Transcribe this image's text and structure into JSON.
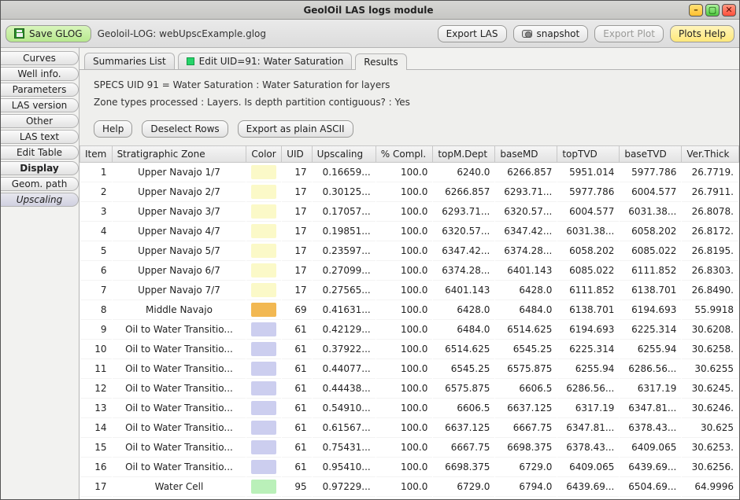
{
  "window": {
    "title": "GeolOil LAS logs module"
  },
  "toolbar": {
    "save": "Save GLOG",
    "filepath": "Geoloil-LOG: webUpscExample.glog",
    "export_las": "Export LAS",
    "snapshot": "snapshot",
    "export_plot": "Export Plot",
    "plots_help": "Plots Help"
  },
  "sidebar": {
    "items": [
      {
        "label": "Curves"
      },
      {
        "label": "Well info."
      },
      {
        "label": "Parameters"
      },
      {
        "label": "LAS version"
      },
      {
        "label": "Other"
      },
      {
        "label": "LAS text"
      },
      {
        "label": "Edit Table"
      },
      {
        "label": "Display",
        "bold": true
      },
      {
        "label": "Geom. path"
      },
      {
        "label": "Upscaling",
        "selected": true
      }
    ]
  },
  "tabs": {
    "summaries": "Summaries List",
    "edit": "Edit UID=91: Water Saturation",
    "results": "Results"
  },
  "specs": {
    "line1": "SPECS UID 91 = Water Saturation : Water Saturation for layers",
    "line2": "Zone types processed : Layers.     Is depth partition contiguous? : Yes"
  },
  "buttons": {
    "help": "Help",
    "deselect": "Deselect Rows",
    "export_ascii": "Export as plain ASCII"
  },
  "columns": [
    "Item",
    "Stratigraphic Zone",
    "Color",
    "UID",
    "Upscaling",
    "% Compl.",
    "topM.Dept",
    "baseMD",
    "topTVD",
    "baseTVD",
    "Ver.Thick"
  ],
  "rows": [
    {
      "item": "1",
      "zone": "Upper Navajo 1/7",
      "color": "#fbf9c8",
      "uid": "17",
      "up": "0.16659...",
      "comp": "100.0",
      "topmd": "6240.0",
      "basemd": "6266.857",
      "toptvd": "5951.014",
      "basetvd": "5977.786",
      "thick": "26.7719."
    },
    {
      "item": "2",
      "zone": "Upper Navajo 2/7",
      "color": "#fbf9c8",
      "uid": "17",
      "up": "0.30125...",
      "comp": "100.0",
      "topmd": "6266.857",
      "basemd": "6293.71...",
      "toptvd": "5977.786",
      "basetvd": "6004.577",
      "thick": "26.7911."
    },
    {
      "item": "3",
      "zone": "Upper Navajo 3/7",
      "color": "#fbf9c8",
      "uid": "17",
      "up": "0.17057...",
      "comp": "100.0",
      "topmd": "6293.71...",
      "basemd": "6320.57...",
      "toptvd": "6004.577",
      "basetvd": "6031.38...",
      "thick": "26.8078."
    },
    {
      "item": "4",
      "zone": "Upper Navajo 4/7",
      "color": "#fbf9c8",
      "uid": "17",
      "up": "0.19851...",
      "comp": "100.0",
      "topmd": "6320.57...",
      "basemd": "6347.42...",
      "toptvd": "6031.38...",
      "basetvd": "6058.202",
      "thick": "26.8172."
    },
    {
      "item": "5",
      "zone": "Upper Navajo 5/7",
      "color": "#fbf9c8",
      "uid": "17",
      "up": "0.23597...",
      "comp": "100.0",
      "topmd": "6347.42...",
      "basemd": "6374.28...",
      "toptvd": "6058.202",
      "basetvd": "6085.022",
      "thick": "26.8195."
    },
    {
      "item": "6",
      "zone": "Upper Navajo 6/7",
      "color": "#fbf9c8",
      "uid": "17",
      "up": "0.27099...",
      "comp": "100.0",
      "topmd": "6374.28...",
      "basemd": "6401.143",
      "toptvd": "6085.022",
      "basetvd": "6111.852",
      "thick": "26.8303."
    },
    {
      "item": "7",
      "zone": "Upper Navajo 7/7",
      "color": "#fbf9c8",
      "uid": "17",
      "up": "0.27565...",
      "comp": "100.0",
      "topmd": "6401.143",
      "basemd": "6428.0",
      "toptvd": "6111.852",
      "basetvd": "6138.701",
      "thick": "26.8490."
    },
    {
      "item": "8",
      "zone": "Middle Navajo",
      "color": "#f2b852",
      "uid": "69",
      "up": "0.41631...",
      "comp": "100.0",
      "topmd": "6428.0",
      "basemd": "6484.0",
      "toptvd": "6138.701",
      "basetvd": "6194.693",
      "thick": "55.9918"
    },
    {
      "item": "9",
      "zone": "Oil to Water Transitio...",
      "color": "#ccceef",
      "uid": "61",
      "up": "0.42129...",
      "comp": "100.0",
      "topmd": "6484.0",
      "basemd": "6514.625",
      "toptvd": "6194.693",
      "basetvd": "6225.314",
      "thick": "30.6208."
    },
    {
      "item": "10",
      "zone": "Oil to Water Transitio...",
      "color": "#ccceef",
      "uid": "61",
      "up": "0.37922...",
      "comp": "100.0",
      "topmd": "6514.625",
      "basemd": "6545.25",
      "toptvd": "6225.314",
      "basetvd": "6255.94",
      "thick": "30.6258."
    },
    {
      "item": "11",
      "zone": "Oil to Water Transitio...",
      "color": "#ccceef",
      "uid": "61",
      "up": "0.44077...",
      "comp": "100.0",
      "topmd": "6545.25",
      "basemd": "6575.875",
      "toptvd": "6255.94",
      "basetvd": "6286.56...",
      "thick": "30.6255"
    },
    {
      "item": "12",
      "zone": "Oil to Water Transitio...",
      "color": "#ccceef",
      "uid": "61",
      "up": "0.44438...",
      "comp": "100.0",
      "topmd": "6575.875",
      "basemd": "6606.5",
      "toptvd": "6286.56...",
      "basetvd": "6317.19",
      "thick": "30.6245."
    },
    {
      "item": "13",
      "zone": "Oil to Water Transitio...",
      "color": "#ccceef",
      "uid": "61",
      "up": "0.54910...",
      "comp": "100.0",
      "topmd": "6606.5",
      "basemd": "6637.125",
      "toptvd": "6317.19",
      "basetvd": "6347.81...",
      "thick": "30.6246."
    },
    {
      "item": "14",
      "zone": "Oil to Water Transitio...",
      "color": "#ccceef",
      "uid": "61",
      "up": "0.61567...",
      "comp": "100.0",
      "topmd": "6637.125",
      "basemd": "6667.75",
      "toptvd": "6347.81...",
      "basetvd": "6378.43...",
      "thick": "30.625"
    },
    {
      "item": "15",
      "zone": "Oil to Water Transitio...",
      "color": "#ccceef",
      "uid": "61",
      "up": "0.75431...",
      "comp": "100.0",
      "topmd": "6667.75",
      "basemd": "6698.375",
      "toptvd": "6378.43...",
      "basetvd": "6409.065",
      "thick": "30.6253."
    },
    {
      "item": "16",
      "zone": "Oil to Water Transitio...",
      "color": "#ccceef",
      "uid": "61",
      "up": "0.95410...",
      "comp": "100.0",
      "topmd": "6698.375",
      "basemd": "6729.0",
      "toptvd": "6409.065",
      "basetvd": "6439.69...",
      "thick": "30.6256."
    },
    {
      "item": "17",
      "zone": "Water Cell",
      "color": "#baf0b9",
      "uid": "95",
      "up": "0.97229...",
      "comp": "100.0",
      "topmd": "6729.0",
      "basemd": "6794.0",
      "toptvd": "6439.69...",
      "basetvd": "6504.69...",
      "thick": "64.9996"
    }
  ]
}
